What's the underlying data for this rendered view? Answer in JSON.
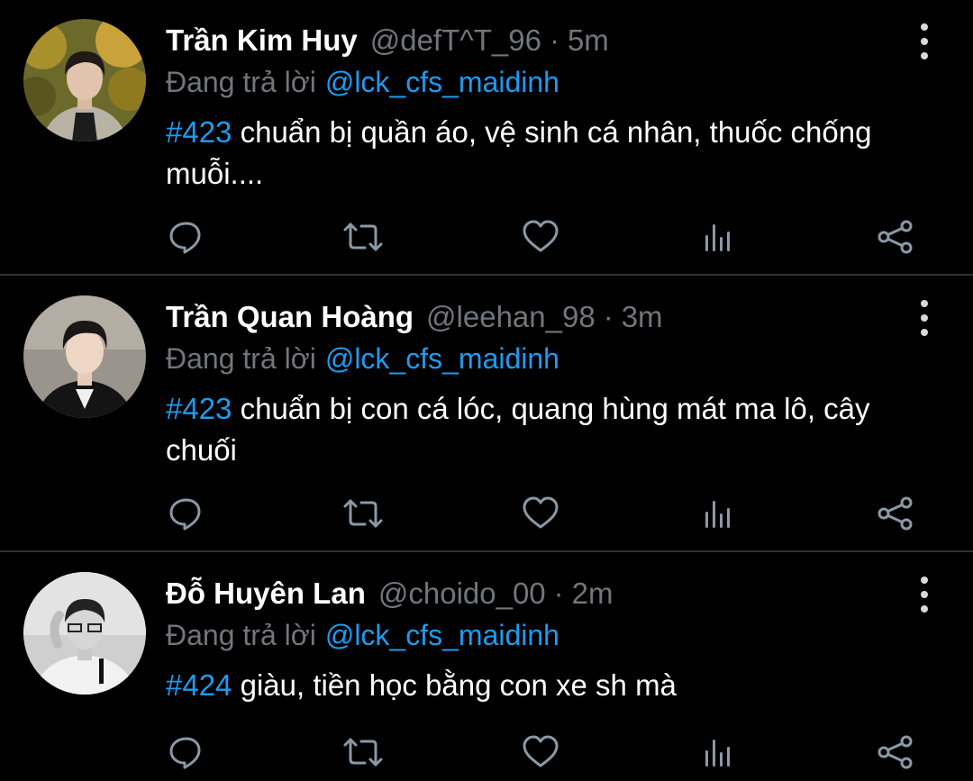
{
  "colors": {
    "background": "#000000",
    "divider": "#2f3336",
    "primary_text": "#ffffff",
    "secondary_text": "#71767b",
    "accent": "#1d9bf0",
    "icon": "#8b98a5"
  },
  "icons": {
    "more": "more-vertical-icon",
    "reply": "speech-bubble-icon",
    "retweet": "retweet-icon",
    "like": "heart-icon",
    "analytics": "bar-chart-icon",
    "share": "share-icon"
  },
  "tweets": [
    {
      "name": "Trần Kim Huy",
      "handle": "@defT^T_96",
      "separator": "·",
      "time": "5m",
      "reply_prefix": "Đang trả lời",
      "reply_to": "@lck_cfs_maidinh",
      "hashtag": "#423",
      "text": "chuẩn bị quần áo, vệ sinh cá nhân, thuốc chống muỗi...."
    },
    {
      "name": "Trần Quan Hoàng",
      "handle": "@leehan_98",
      "separator": "·",
      "time": "3m",
      "reply_prefix": "Đang trả lời",
      "reply_to": "@lck_cfs_maidinh",
      "hashtag": "#423",
      "text": "chuẩn bị con cá lóc, quang hùng mát ma lô, cây chuối"
    },
    {
      "name": "Đỗ Huyên Lan",
      "handle": "@choido_00",
      "separator": "·",
      "time": "2m",
      "reply_prefix": "Đang trả lời",
      "reply_to": "@lck_cfs_maidinh",
      "hashtag": "#424",
      "text": "giàu, tiền học bằng con xe sh mà"
    }
  ]
}
